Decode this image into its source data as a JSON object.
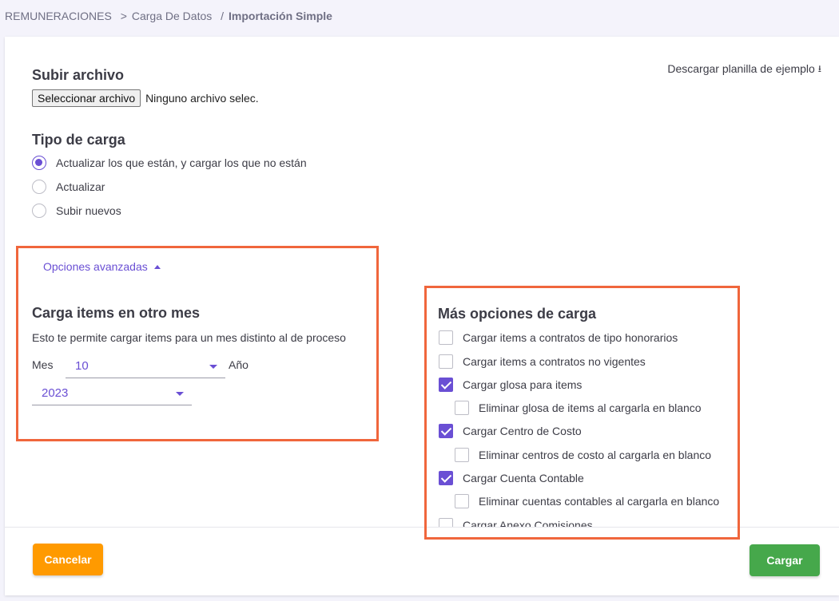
{
  "breadcrumb": {
    "root": "REMUNERACIONES",
    "sep1": ">",
    "section": "Carga De Datos",
    "sep2": "/",
    "current": "Importación Simple"
  },
  "download": {
    "label": "Descargar planilla de ejemplo",
    "icon": "download-icon"
  },
  "upload": {
    "title": "Subir archivo",
    "button_label": "Seleccionar archivo",
    "status": "Ninguno archivo selec."
  },
  "load_type": {
    "title": "Tipo de carga",
    "options": [
      {
        "label": "Actualizar los que están, y cargar los que no están",
        "selected": true
      },
      {
        "label": "Actualizar",
        "selected": false
      },
      {
        "label": "Subir nuevos",
        "selected": false
      }
    ]
  },
  "advanced": {
    "toggle_label": "Opciones avanzadas",
    "title": "Carga items en otro mes",
    "description": "Esto te permite cargar items para un mes distinto al de proceso",
    "month_label": "Mes",
    "month_value": "10",
    "year_label": "Año",
    "year_value": "2023"
  },
  "more_options": {
    "title": "Más opciones de carga",
    "items": [
      {
        "label": "Cargar items a contratos de tipo honorarios",
        "checked": false,
        "indent": false
      },
      {
        "label": "Cargar items a contratos no vigentes",
        "checked": false,
        "indent": false
      },
      {
        "label": "Cargar glosa para items",
        "checked": true,
        "indent": false
      },
      {
        "label": "Eliminar glosa de items al cargarla en blanco",
        "checked": false,
        "indent": true
      },
      {
        "label": "Cargar Centro de Costo",
        "checked": true,
        "indent": false
      },
      {
        "label": "Eliminar centros de costo al cargarla en blanco",
        "checked": false,
        "indent": true
      },
      {
        "label": "Cargar Cuenta Contable",
        "checked": true,
        "indent": false
      },
      {
        "label": "Eliminar cuentas contables al cargarla en blanco",
        "checked": false,
        "indent": true
      },
      {
        "label": "Cargar Anexo Comisiones",
        "checked": false,
        "indent": false
      }
    ]
  },
  "actions": {
    "cancel_label": "Cancelar",
    "submit_label": "Cargar"
  },
  "colors": {
    "accent": "#6a4fd4",
    "highlight": "#f0663c",
    "cancel": "#ff9a00",
    "submit": "#46a84b"
  }
}
